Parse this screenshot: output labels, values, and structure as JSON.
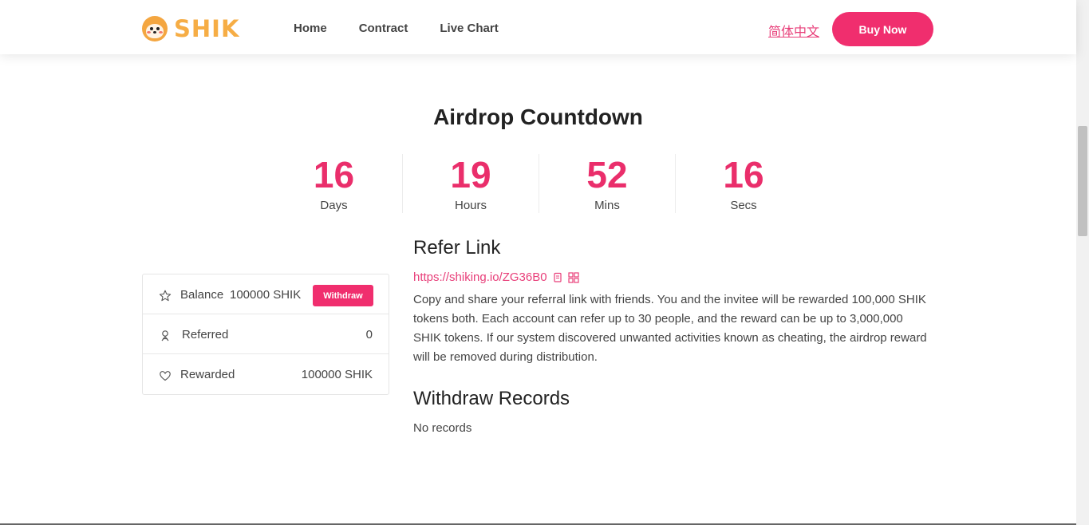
{
  "header": {
    "logo_text": "SHIK",
    "nav": [
      "Home",
      "Contract",
      "Live Chart"
    ],
    "language": "简体中文",
    "buy_label": "Buy Now"
  },
  "countdown": {
    "title": "Airdrop Countdown",
    "units": [
      {
        "value": "16",
        "label": "Days"
      },
      {
        "value": "19",
        "label": "Hours"
      },
      {
        "value": "52",
        "label": "Mins"
      },
      {
        "value": "16",
        "label": "Secs"
      }
    ]
  },
  "stats": {
    "balance_label": "Balance",
    "balance_value": "100000 SHIK",
    "withdraw_label": "Withdraw",
    "referred_label": "Referred",
    "referred_value": "0",
    "rewarded_label": "Rewarded",
    "rewarded_value": "100000 SHIK"
  },
  "refer": {
    "heading": "Refer Link",
    "link": "https://shiking.io/ZG36B0",
    "description": "Copy and share your referral link with friends. You and the invitee will be rewarded 100,000 SHIK tokens both. Each account can refer up to 30 people, and the reward can be up to 3,000,000 SHIK tokens. If our system discovered unwanted activities known as cheating, the airdrop reward will be removed during distribution."
  },
  "withdraw_records": {
    "heading": "Withdraw Records",
    "empty_text": "No records"
  },
  "colors": {
    "accent": "#f02e6e",
    "logo": "#f6ad45"
  },
  "icons": [
    "shiba-logo-icon",
    "star-icon",
    "user-icon",
    "heart-icon",
    "copy-icon",
    "qrcode-icon"
  ]
}
